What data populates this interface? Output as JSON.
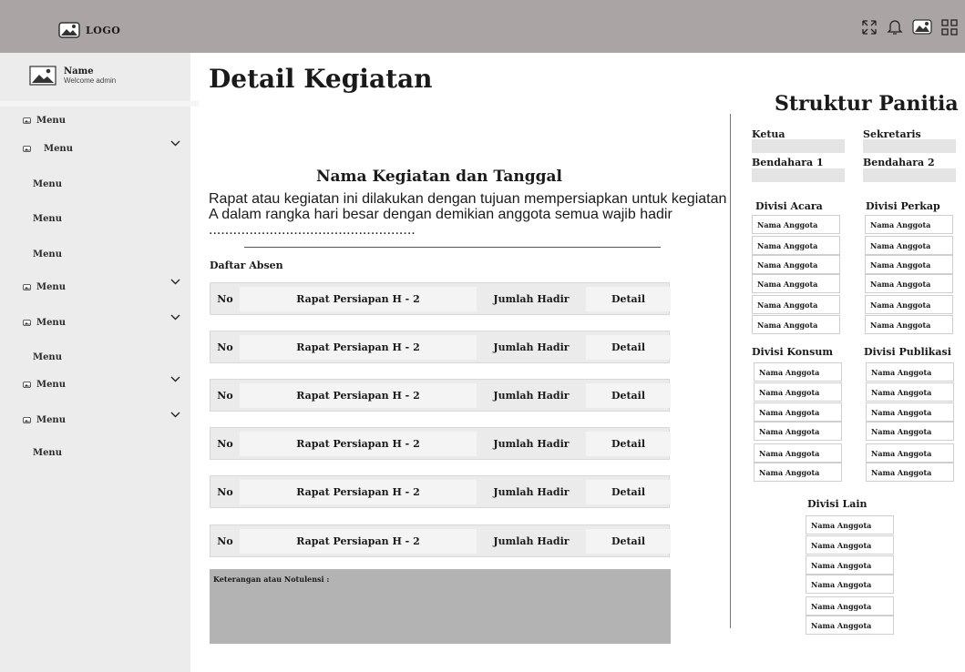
{
  "topbar": {
    "logo_text": "LOGO",
    "icons": [
      "expand-icon",
      "bell-icon",
      "image-icon",
      "grid-icon"
    ]
  },
  "user": {
    "name": "Name",
    "welcome": "Welcome admin"
  },
  "sidebar": {
    "items": [
      {
        "label": "Menu",
        "icon": true,
        "chevron": false
      },
      {
        "label": "Menu",
        "icon": true,
        "chevron": true
      },
      {
        "label": "Menu",
        "icon": false,
        "chevron": false
      },
      {
        "label": "Menu",
        "icon": false,
        "chevron": false
      },
      {
        "label": "Menu",
        "icon": false,
        "chevron": false
      },
      {
        "label": "Menu",
        "icon": true,
        "chevron": true
      },
      {
        "label": "Menu",
        "icon": true,
        "chevron": true
      },
      {
        "label": "Menu",
        "icon": false,
        "chevron": false
      },
      {
        "label": "Menu",
        "icon": true,
        "chevron": true
      },
      {
        "label": "Menu",
        "icon": true,
        "chevron": true
      },
      {
        "label": "Menu",
        "icon": false,
        "chevron": false
      }
    ]
  },
  "main": {
    "title": "Detail Kegiatan",
    "event_title": "Nama Kegiatan dan Tanggal",
    "description": "Rapat atau kegiatan ini dilakukan dengan tujuan mempersiapkan untuk kegiatan A dalam rangka hari besar dengan demikian anggota semua wajib hadir ...................................................",
    "absen_label": "Daftar Absen",
    "rows": [
      {
        "no": "No",
        "name": "Rapat Persiapan H - 2",
        "jumlah": "Jumlah Hadir",
        "detail": "Detail"
      },
      {
        "no": "No",
        "name": "Rapat Persiapan H - 2",
        "jumlah": "Jumlah Hadir",
        "detail": "Detail"
      },
      {
        "no": "No",
        "name": "Rapat Persiapan H - 2",
        "jumlah": "Jumlah Hadir",
        "detail": "Detail"
      },
      {
        "no": "No",
        "name": "Rapat Persiapan H - 2",
        "jumlah": "Jumlah Hadir",
        "detail": "Detail"
      },
      {
        "no": "No",
        "name": "Rapat Persiapan H - 2",
        "jumlah": "Jumlah Hadir",
        "detail": "Detail"
      },
      {
        "no": "No",
        "name": "Rapat Persiapan H - 2",
        "jumlah": "Jumlah Hadir",
        "detail": "Detail"
      }
    ],
    "notes_label": "Keterangan atau Notulensi :"
  },
  "panel": {
    "title": "Struktur Panitia",
    "roles": {
      "ketua": "Ketua",
      "sekretaris": "Sekretaris",
      "bendahara1": "Bendahara 1",
      "bendahara2": "Bendahara 2"
    },
    "divisions": {
      "acara": {
        "title": "Divisi Acara",
        "members": [
          "Nama Anggota",
          "Nama Anggota",
          "Nama Anggota",
          "Nama Anggota",
          "Nama Anggota",
          "Nama Anggota"
        ]
      },
      "perkap": {
        "title": "Divisi Perkap",
        "members": [
          "Nama Anggota",
          "Nama Anggota",
          "Nama Anggota",
          "Nama Anggota",
          "Nama Anggota",
          "Nama Anggota"
        ]
      },
      "konsum": {
        "title": "Divisi Konsum",
        "members": [
          "Nama Anggota",
          "Nama Anggota",
          "Nama Anggota",
          "Nama Anggota",
          "Nama Anggota",
          "Nama Anggota"
        ]
      },
      "publikasi": {
        "title": "Divisi Publikasi",
        "members": [
          "Nama Anggota",
          "Nama Anggota",
          "Nama Anggota",
          "Nama Anggota",
          "Nama Anggota",
          "Nama Anggota"
        ]
      },
      "lain": {
        "title": "Divisi Lain",
        "members": [
          "Nama Anggota",
          "Nama Anggota",
          "Nama Anggota",
          "Nama Anggota",
          "Nama Anggota",
          "Nama Anggota"
        ]
      }
    }
  }
}
